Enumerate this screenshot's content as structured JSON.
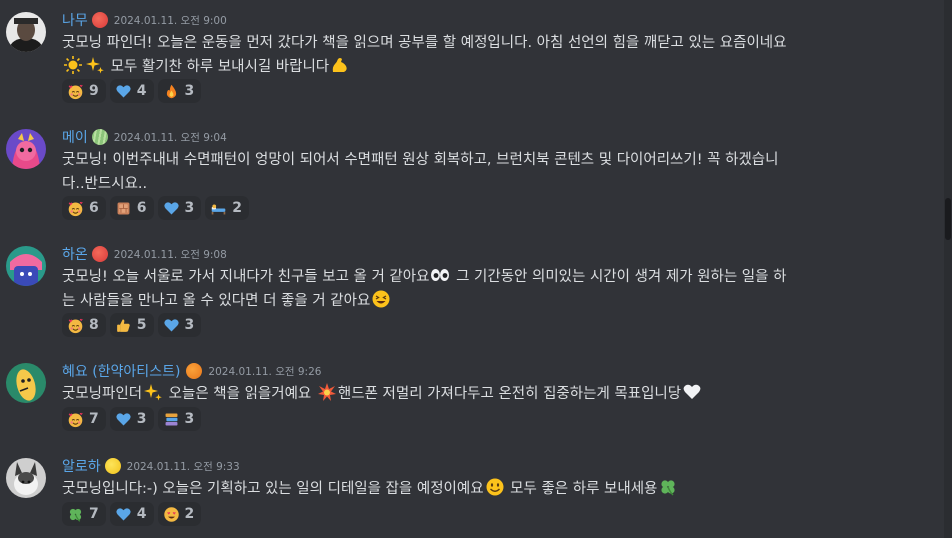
{
  "colors": {
    "background": "#313338",
    "name_blue": "#5aa6e8",
    "time": "#949ba4",
    "text": "#dbdee1",
    "reaction_bg": "#2b2d31"
  },
  "messages": [
    {
      "author": "나무",
      "badge_icon": "peach-badge-icon",
      "timestamp": "2024.01.11. 오전 9:00",
      "lines": [
        "굿모닝 파인더! 오늘은 운동을 먼저 갔다가 책을 읽으며 공부를 할 예정입니다. 아침 선언의 힘을 깨닫고 있는 요즘이네요"
      ],
      "line2": "모두 활기찬 하루 보내시길 바랍니다",
      "reactions": [
        {
          "icon": "smiling-face-with-hearts-icon",
          "count": "9"
        },
        {
          "icon": "blue-heart-icon",
          "count": "4"
        },
        {
          "icon": "fire-icon",
          "count": "3"
        }
      ]
    },
    {
      "author": "메이",
      "badge_icon": "melon-badge-icon",
      "timestamp": "2024.01.11. 오전 9:04",
      "text1": "굿모닝! 이번주내내 수면패턴이 엉망이 되어서 수면패턴 원상 회복하고, 브런치북 콘텐츠 및 다이어리쓰기! 꼭 하겠습니",
      "text2": "다..반드시요..",
      "reactions": [
        {
          "icon": "smiling-face-with-hearts-icon",
          "count": "6"
        },
        {
          "icon": "brick-icon",
          "count": "6"
        },
        {
          "icon": "blue-heart-icon",
          "count": "3"
        },
        {
          "icon": "sleeping-bed-icon",
          "count": "2"
        }
      ]
    },
    {
      "author": "하온",
      "badge_icon": "peach-badge-icon",
      "timestamp": "2024.01.11. 오전 9:08",
      "text1": "굿모닝! 오늘 서울로 가서 지내다가 친구들 보고 올 거 같아요",
      "text1b": "그 기간동안 의미있는 시간이 생겨 제가 원하는 일을 하",
      "text2": "는 사람들을 만나고 올 수 있다면 더 좋을 거 같아요",
      "reactions": [
        {
          "icon": "smiling-face-with-hearts-icon",
          "count": "8"
        },
        {
          "icon": "thumbs-up-icon",
          "count": "5"
        },
        {
          "icon": "blue-heart-icon",
          "count": "3"
        }
      ]
    },
    {
      "author": "혜요 (한약아티스트)",
      "badge_icon": "tangerine-badge-icon",
      "timestamp": "2024.01.11. 오전 9:26",
      "text1": "굿모닝파인더",
      "text1b": "오늘은 책을 읽을거예요",
      "text1c": "핸드폰 저멀리 가져다두고 온전히 집중하는게 목표입니당",
      "reactions": [
        {
          "icon": "smiling-face-with-hearts-icon",
          "count": "7"
        },
        {
          "icon": "blue-heart-icon",
          "count": "3"
        },
        {
          "icon": "books-icon",
          "count": "3"
        }
      ]
    },
    {
      "author": "알로하",
      "badge_icon": "lemon-badge-icon",
      "timestamp": "2024.01.11. 오전 9:33",
      "text1": "굿모닝입니다:-) 오늘은 기획하고 있는 일의 디테일을 잡을 예정이예요",
      "text1b": "모두 좋은 하루 보내세용",
      "reactions": [
        {
          "icon": "four-leaf-clover-icon",
          "count": "7"
        },
        {
          "icon": "blue-heart-icon",
          "count": "4"
        },
        {
          "icon": "heart-eyes-icon",
          "count": "2"
        }
      ]
    }
  ]
}
